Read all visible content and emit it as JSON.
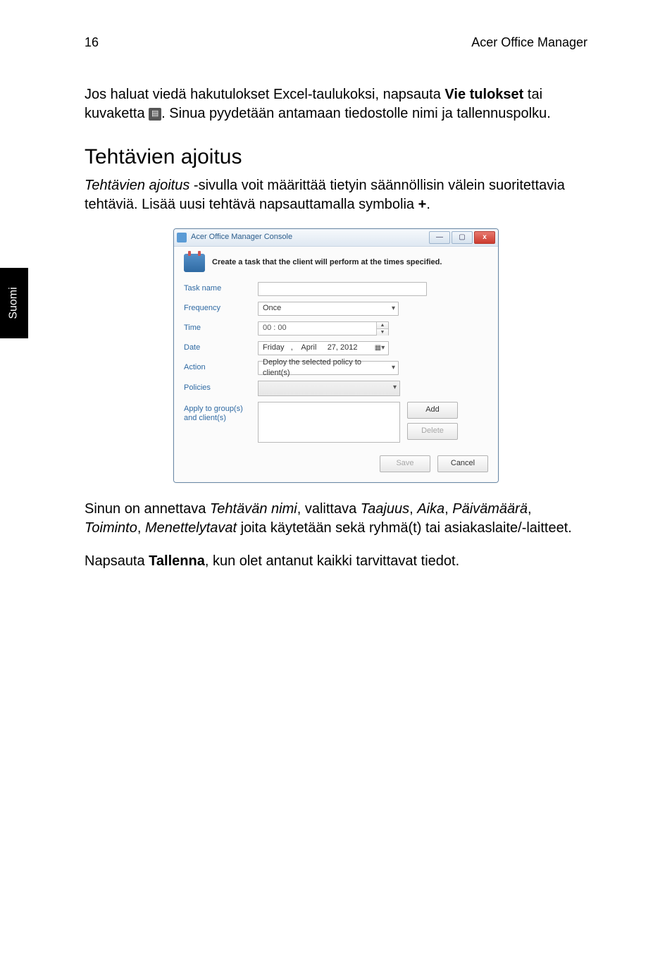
{
  "header": {
    "page": "16",
    "product": "Acer Office Manager"
  },
  "side_tab": "Suomi",
  "para1_a": "Jos haluat viedä hakutulokset Excel-taulukoksi, napsauta ",
  "para1_b": "Vie tulokset",
  "para1_c": " tai kuvaketta ",
  "para1_d": ". Sinua pyydetään antamaan tiedostolle nimi ja tallennuspolku.",
  "section_title": "Tehtävien ajoitus",
  "para2_a": "Tehtävien ajoitus",
  "para2_b": " -sivulla voit määrittää tietyin säännöllisin välein suoritettavia tehtäviä. Lisää uusi tehtävä napsauttamalla symbolia ",
  "para2_c": "+",
  "para2_d": ".",
  "dialog": {
    "title": "Acer Office Manager Console",
    "heading": "Create a task that the client will perform at the times specified.",
    "labels": {
      "task": "Task name",
      "freq": "Frequency",
      "time": "Time",
      "date": "Date",
      "action": "Action",
      "policies": "Policies",
      "apply1": "Apply to group(s)",
      "apply2": "and client(s)"
    },
    "values": {
      "freq": "Once",
      "time": "00 : 00",
      "date": "Friday   ,    April     27, 2012",
      "action": "Deploy the selected policy to client(s)"
    },
    "buttons": {
      "add": "Add",
      "delete": "Delete",
      "save": "Save",
      "cancel": "Cancel"
    }
  },
  "para3_a": "Sinun on annettava ",
  "para3_b": "Tehtävän nimi",
  "para3_c": ", valittava ",
  "para3_d": "Taajuus",
  "para3_e": ", ",
  "para3_f": "Aika",
  "para3_g": ", ",
  "para3_h": "Päivämäärä",
  "para3_i": ", ",
  "para3_j": "Toiminto",
  "para3_k": ", ",
  "para3_l": "Menettelytavat",
  "para3_m": " joita käytetään sekä ryhmä(t) tai asiakaslaite/-laitteet.",
  "para4_a": "Napsauta ",
  "para4_b": "Tallenna",
  "para4_c": ", kun olet antanut kaikki tarvittavat tiedot."
}
